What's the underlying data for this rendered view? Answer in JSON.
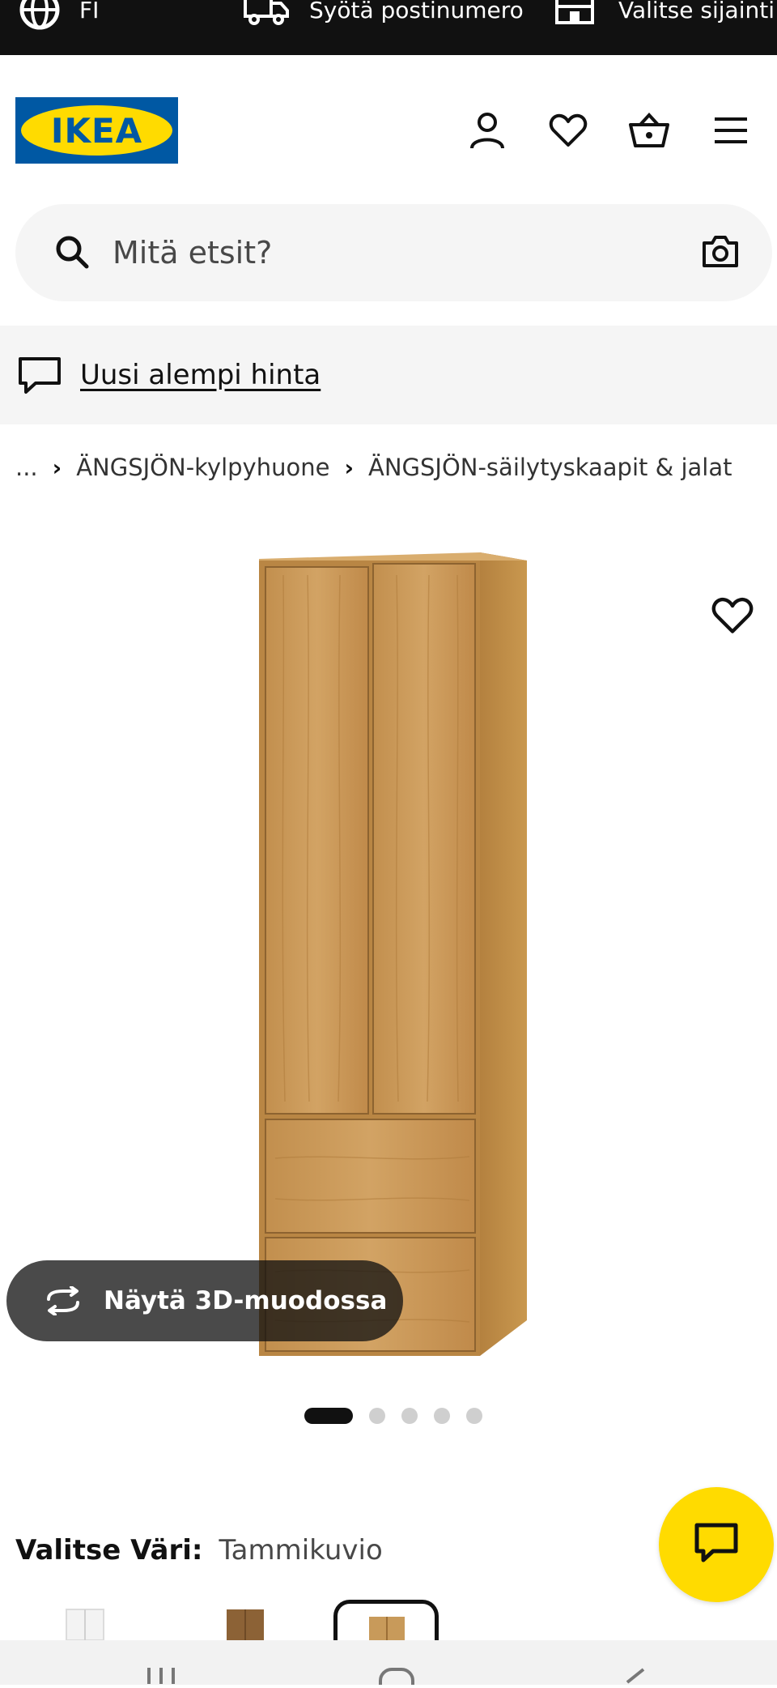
{
  "topbar": {
    "language": "FI",
    "postcode_label": "Syötä postinumero",
    "store_label": "Valitse sijainti"
  },
  "header": {
    "logo_text": "IKEA",
    "icons": [
      "user-icon",
      "heart-icon",
      "basket-icon",
      "menu-icon"
    ]
  },
  "search": {
    "placeholder": "Mitä etsit?"
  },
  "promo": {
    "label": "Uusi alempi hinta"
  },
  "breadcrumb": {
    "ellipsis": "...",
    "items": [
      "ÄNGSJÖN-kylpyhuone",
      "ÄNGSJÖN-säilytyskaapit & jalat"
    ]
  },
  "gallery": {
    "view_3d_label": "Näytä 3D-muodossa",
    "dot_count": 5,
    "active_dot": 1
  },
  "color_selector": {
    "label": "Valitse Väri:",
    "value": "Tammikuvio"
  },
  "colors": {
    "brand_blue": "#0058a3",
    "brand_yellow": "#ffdb00",
    "oak": "#c89a5a"
  }
}
